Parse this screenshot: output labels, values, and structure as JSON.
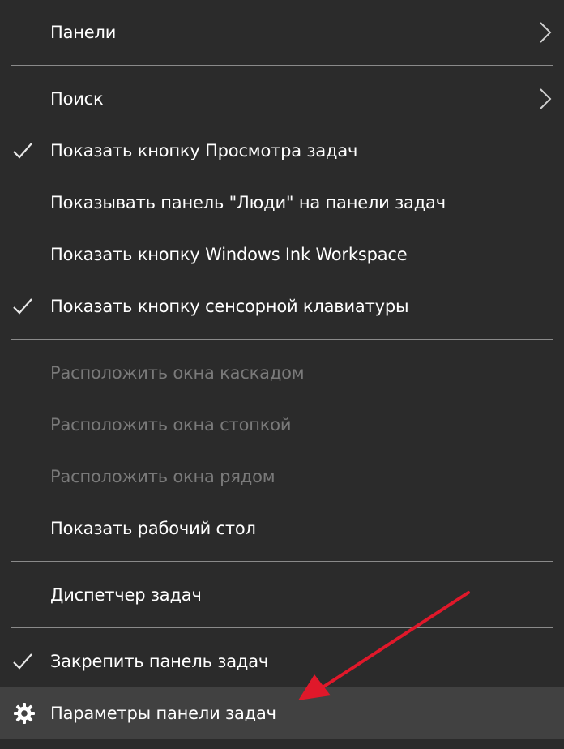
{
  "menu": {
    "items": [
      {
        "label": "Панели",
        "checked": false,
        "submenu": true,
        "disabled": false
      },
      {
        "label": "Поиск",
        "checked": false,
        "submenu": true,
        "disabled": false
      },
      {
        "label": "Показать кнопку Просмотра задач",
        "checked": true,
        "submenu": false,
        "disabled": false
      },
      {
        "label": "Показывать панель \"Люди\" на панели задач",
        "checked": false,
        "submenu": false,
        "disabled": false
      },
      {
        "label": "Показать кнопку Windows Ink Workspace",
        "checked": false,
        "submenu": false,
        "disabled": false
      },
      {
        "label": "Показать кнопку сенсорной клавиатуры",
        "checked": true,
        "submenu": false,
        "disabled": false
      },
      {
        "label": "Расположить окна каскадом",
        "checked": false,
        "submenu": false,
        "disabled": true
      },
      {
        "label": "Расположить окна стопкой",
        "checked": false,
        "submenu": false,
        "disabled": true
      },
      {
        "label": "Расположить окна рядом",
        "checked": false,
        "submenu": false,
        "disabled": true
      },
      {
        "label": "Показать рабочий стол",
        "checked": false,
        "submenu": false,
        "disabled": false
      },
      {
        "label": "Диспетчер задач",
        "checked": false,
        "submenu": false,
        "disabled": false
      },
      {
        "label": "Закрепить панель задач",
        "checked": true,
        "submenu": false,
        "disabled": false
      },
      {
        "label": "Параметры панели задач",
        "checked": false,
        "submenu": false,
        "disabled": false,
        "highlighted": true,
        "icon": "gear-icon"
      }
    ]
  },
  "colors": {
    "background": "#2b2b2b",
    "text": "#ffffff",
    "disabled_text": "#7a7a7a",
    "separator": "#8a8a8a",
    "highlight": "#414141",
    "annotation_arrow": "#e0182a"
  },
  "annotation": {
    "icon": "red-arrow-icon"
  }
}
